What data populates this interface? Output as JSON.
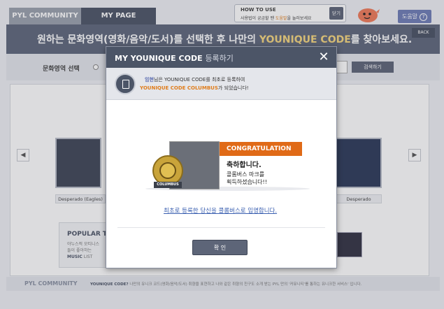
{
  "tabs": {
    "community": "PYL COMMUNITY",
    "mypage": "MY PAGE"
  },
  "howto": {
    "title": "HOW TO USE",
    "text_prefix": "사용법이 궁금할 땐 ",
    "text_link": "도움말",
    "text_suffix": "을 눌러보세요",
    "close_label": "닫기"
  },
  "help": {
    "label": "도움말",
    "icon": "?"
  },
  "header": {
    "headline_prefix": "원하는 문화영역(영화/음악/도서)를 선택한 후 나만의 ",
    "headline_highlight": "YOUNIQUE CODE",
    "headline_suffix": "를 찾아보세요.",
    "back_label": "BACK"
  },
  "filter": {
    "label": "문화영역 선택",
    "search_label": "검색하기"
  },
  "gallery": {
    "prev_icon": "◀",
    "next_icon": "▶",
    "left_caption": "Desperado (Eagles)",
    "right_caption": "Desperado"
  },
  "popular": {
    "title": "POPULAR TIT",
    "text_a": "야누스적 모티니스",
    "text_b": "들이 좋아하는",
    "text_music": "MUSIC",
    "text_list": " LIST"
  },
  "footer": {
    "logo": "PYL COMMUNITY",
    "label": "YOUNIQUE CODE?",
    "text": " 나만의 유니크 코드(영화/음악/도서) 취향을 표현하고 나와 같은 취향의 친구도 소개 받는 PYL 만의 '커뮤니티'를 통하는 유니크한 서비스' 입니다."
  },
  "modal": {
    "title_main": "MY YOUNIQUE CODE",
    "title_sub": "등록하기",
    "close_icon": "✕",
    "notice_name": "임현",
    "notice_line1_suffix": "님은 YOUNIQUE CODE를 최초로 등록하여",
    "notice_line2_highlight": "YOUNIQUE CODE COLUMBUS",
    "notice_line2_suffix": "가 되었습니다!",
    "banner": "CONGRATULATION",
    "congrats_heading": "축하합니다.",
    "congrats_line1": "콜롬버스 마크를",
    "congrats_line2": "획득하셨습니다!!",
    "coin_ribbon": "COLUMBUS",
    "appoint_link": "최초로 등록한 당신을 콜롬버스로 임명합니다.",
    "confirm_label": "확 인"
  },
  "colors": {
    "accent_dark": "#4c5567",
    "orange": "#e06a17",
    "gold": "#c9a43a",
    "link_blue": "#3a5fb0"
  }
}
